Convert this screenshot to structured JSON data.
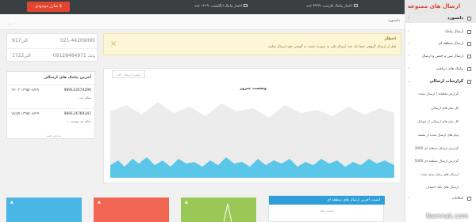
{
  "brand": {
    "title": "ارسال های ممنوعه"
  },
  "topbar": {
    "credit_persian": "اعتبار پیامک فارسی: ۴۹۹۹ عدد",
    "credit_english": "اعتبار پیامک انگلیسی: ۱۳۶۹ عدد",
    "charge_button": "$ شارژ موجودی"
  },
  "breadcrumb": "داشبورد",
  "sidebar": {
    "items": [
      {
        "label": "داشبورد",
        "icon": "home-icon"
      },
      {
        "label": "ارسال پیامک",
        "icon": "send-icon"
      },
      {
        "label": "ارسال منطقه ای",
        "icon": "map-icon"
      },
      {
        "label": "ارسال سن و جنس و ارسال",
        "icon": "users-icon"
      },
      {
        "label": "پیامک های دریافتی",
        "icon": "inbox-icon"
      },
      {
        "label": "گزارشات ارسالی",
        "icon": "report-icon"
      }
    ],
    "sub_items": [
      "گزارش ماهیانه / ارسال مجدد",
      "کل پیام های ارسالی",
      "کل پیام های ارسالی از موبایل",
      "پیام های ارسال شده از نقشه",
      "گزارش ارسال منطقه ای 3000",
      "گزارش ارسال منطقه ای 5000",
      "ارسال های زمان بندی شده",
      "ارسال های بانک اصناف"
    ],
    "last_item": "امکانات"
  },
  "alert": {
    "title": "اخطار",
    "body": "قبل از ارسال گروهی حتما یک عدد ارسال تکی به صورت تست به گوشی خود ارسال نمایید."
  },
  "contact": {
    "phone1": "021-44209095",
    "time1_label": "9الی17",
    "phone2": "09128484971",
    "phone2_label": "پیامک",
    "time2_label": "17الی22"
  },
  "recent": {
    "title": "آخرین پیامک های ارسالی",
    "messages": [
      {
        "phone": "989123574290",
        "date": "۱۴:۰۳ ۱۳۹۵/۰۸/۲۹",
        "text": "سلام عد..."
      },
      {
        "phone": "989124769347",
        "date": "۱۵:۵۹ ۱۳۹۵/۰۸/۲۹",
        "text": "سلام عد تپیست ..."
      }
    ],
    "more": "نمایش همه"
  },
  "chart_panel": {
    "tab": "کیفیت ارسال: ۱۸۷",
    "title": "وضعیت سرور"
  },
  "latest": {
    "title": "لیست آخرین ارسال های منطقه ای",
    "more": "نمایش همه"
  },
  "colors": {
    "accent_red": "#e2452f",
    "tile_blue": "#49b6e5",
    "tile_red": "#f06652",
    "tile_green": "#9ac856",
    "chart_fill": "#5bc7e8",
    "chart_bg": "#ececec"
  },
  "watermark": "Namnak.com"
}
